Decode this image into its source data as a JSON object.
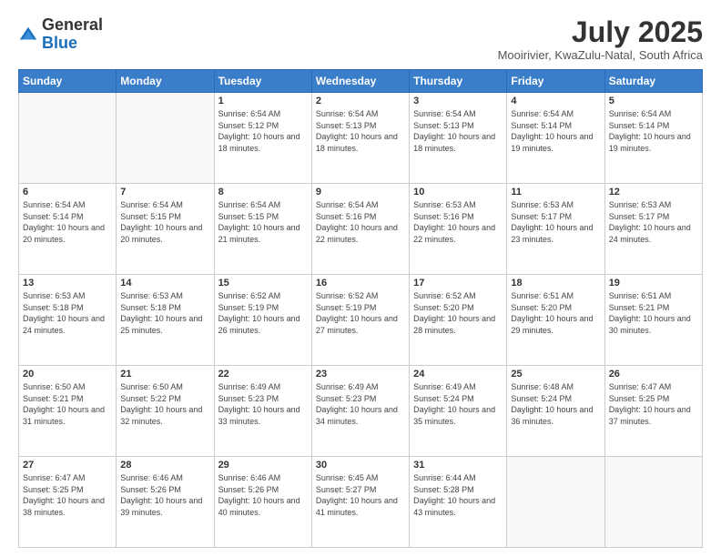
{
  "header": {
    "logo_general": "General",
    "logo_blue": "Blue",
    "main_title": "July 2025",
    "sub_title": "Mooirivier, KwaZulu-Natal, South Africa"
  },
  "days_of_week": [
    "Sunday",
    "Monday",
    "Tuesday",
    "Wednesday",
    "Thursday",
    "Friday",
    "Saturday"
  ],
  "weeks": [
    [
      {
        "day": "",
        "info": ""
      },
      {
        "day": "",
        "info": ""
      },
      {
        "day": "1",
        "info": "Sunrise: 6:54 AM\nSunset: 5:12 PM\nDaylight: 10 hours and 18 minutes."
      },
      {
        "day": "2",
        "info": "Sunrise: 6:54 AM\nSunset: 5:13 PM\nDaylight: 10 hours and 18 minutes."
      },
      {
        "day": "3",
        "info": "Sunrise: 6:54 AM\nSunset: 5:13 PM\nDaylight: 10 hours and 18 minutes."
      },
      {
        "day": "4",
        "info": "Sunrise: 6:54 AM\nSunset: 5:14 PM\nDaylight: 10 hours and 19 minutes."
      },
      {
        "day": "5",
        "info": "Sunrise: 6:54 AM\nSunset: 5:14 PM\nDaylight: 10 hours and 19 minutes."
      }
    ],
    [
      {
        "day": "6",
        "info": "Sunrise: 6:54 AM\nSunset: 5:14 PM\nDaylight: 10 hours and 20 minutes."
      },
      {
        "day": "7",
        "info": "Sunrise: 6:54 AM\nSunset: 5:15 PM\nDaylight: 10 hours and 20 minutes."
      },
      {
        "day": "8",
        "info": "Sunrise: 6:54 AM\nSunset: 5:15 PM\nDaylight: 10 hours and 21 minutes."
      },
      {
        "day": "9",
        "info": "Sunrise: 6:54 AM\nSunset: 5:16 PM\nDaylight: 10 hours and 22 minutes."
      },
      {
        "day": "10",
        "info": "Sunrise: 6:53 AM\nSunset: 5:16 PM\nDaylight: 10 hours and 22 minutes."
      },
      {
        "day": "11",
        "info": "Sunrise: 6:53 AM\nSunset: 5:17 PM\nDaylight: 10 hours and 23 minutes."
      },
      {
        "day": "12",
        "info": "Sunrise: 6:53 AM\nSunset: 5:17 PM\nDaylight: 10 hours and 24 minutes."
      }
    ],
    [
      {
        "day": "13",
        "info": "Sunrise: 6:53 AM\nSunset: 5:18 PM\nDaylight: 10 hours and 24 minutes."
      },
      {
        "day": "14",
        "info": "Sunrise: 6:53 AM\nSunset: 5:18 PM\nDaylight: 10 hours and 25 minutes."
      },
      {
        "day": "15",
        "info": "Sunrise: 6:52 AM\nSunset: 5:19 PM\nDaylight: 10 hours and 26 minutes."
      },
      {
        "day": "16",
        "info": "Sunrise: 6:52 AM\nSunset: 5:19 PM\nDaylight: 10 hours and 27 minutes."
      },
      {
        "day": "17",
        "info": "Sunrise: 6:52 AM\nSunset: 5:20 PM\nDaylight: 10 hours and 28 minutes."
      },
      {
        "day": "18",
        "info": "Sunrise: 6:51 AM\nSunset: 5:20 PM\nDaylight: 10 hours and 29 minutes."
      },
      {
        "day": "19",
        "info": "Sunrise: 6:51 AM\nSunset: 5:21 PM\nDaylight: 10 hours and 30 minutes."
      }
    ],
    [
      {
        "day": "20",
        "info": "Sunrise: 6:50 AM\nSunset: 5:21 PM\nDaylight: 10 hours and 31 minutes."
      },
      {
        "day": "21",
        "info": "Sunrise: 6:50 AM\nSunset: 5:22 PM\nDaylight: 10 hours and 32 minutes."
      },
      {
        "day": "22",
        "info": "Sunrise: 6:49 AM\nSunset: 5:23 PM\nDaylight: 10 hours and 33 minutes."
      },
      {
        "day": "23",
        "info": "Sunrise: 6:49 AM\nSunset: 5:23 PM\nDaylight: 10 hours and 34 minutes."
      },
      {
        "day": "24",
        "info": "Sunrise: 6:49 AM\nSunset: 5:24 PM\nDaylight: 10 hours and 35 minutes."
      },
      {
        "day": "25",
        "info": "Sunrise: 6:48 AM\nSunset: 5:24 PM\nDaylight: 10 hours and 36 minutes."
      },
      {
        "day": "26",
        "info": "Sunrise: 6:47 AM\nSunset: 5:25 PM\nDaylight: 10 hours and 37 minutes."
      }
    ],
    [
      {
        "day": "27",
        "info": "Sunrise: 6:47 AM\nSunset: 5:25 PM\nDaylight: 10 hours and 38 minutes."
      },
      {
        "day": "28",
        "info": "Sunrise: 6:46 AM\nSunset: 5:26 PM\nDaylight: 10 hours and 39 minutes."
      },
      {
        "day": "29",
        "info": "Sunrise: 6:46 AM\nSunset: 5:26 PM\nDaylight: 10 hours and 40 minutes."
      },
      {
        "day": "30",
        "info": "Sunrise: 6:45 AM\nSunset: 5:27 PM\nDaylight: 10 hours and 41 minutes."
      },
      {
        "day": "31",
        "info": "Sunrise: 6:44 AM\nSunset: 5:28 PM\nDaylight: 10 hours and 43 minutes."
      },
      {
        "day": "",
        "info": ""
      },
      {
        "day": "",
        "info": ""
      }
    ]
  ]
}
